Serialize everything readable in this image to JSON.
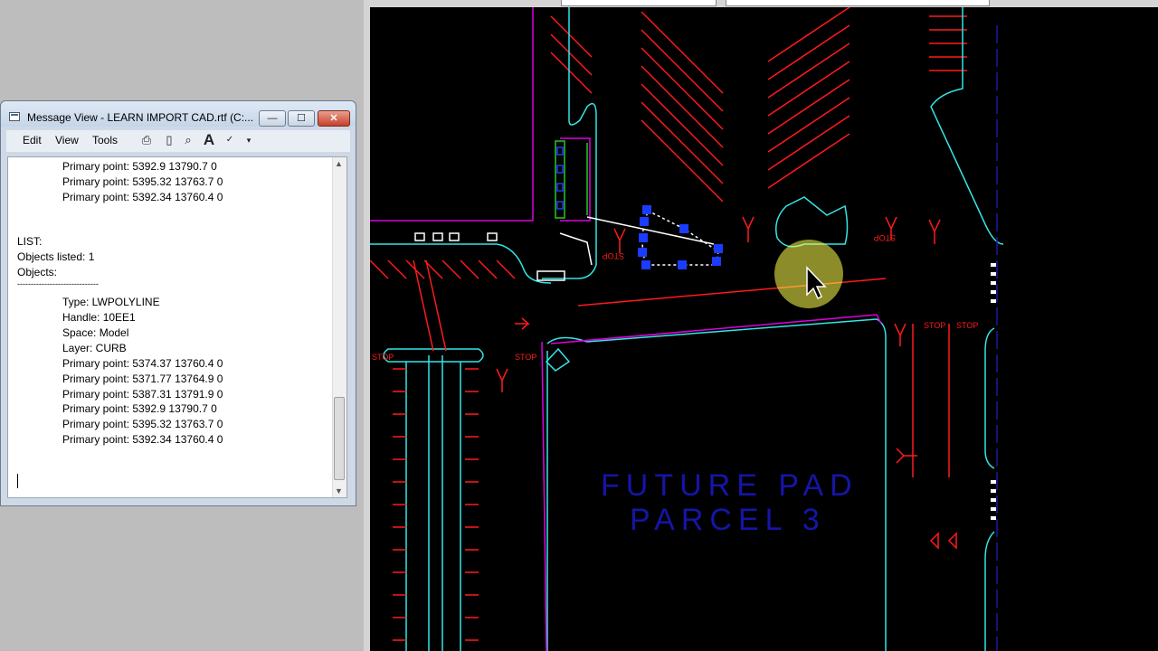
{
  "message_view": {
    "title": "Message View - LEARN IMPORT CAD.rtf (C:...",
    "buttons": {
      "minimize": "—",
      "maximize": "☐",
      "close": "✕"
    },
    "menu": [
      "Edit",
      "View",
      "Tools"
    ],
    "lines": [
      "Primary point: 5392.9 13790.7 0",
      "Primary point: 5395.32 13763.7 0",
      "Primary point: 5392.34 13760.4 0",
      "LIST:",
      "Objects listed: 1",
      "Objects:",
      "------------------------------",
      "Type: LWPOLYLINE",
      "Handle: 10EE1",
      "Space: Model",
      "Layer: CURB",
      "Primary point: 5374.37 13760.4 0",
      "Primary point: 5371.77 13764.9 0",
      "Primary point: 5387.31 13791.9 0",
      "Primary point: 5392.9 13790.7 0",
      "Primary point: 5395.32 13763.7 0",
      "Primary point: 5392.34 13760.4 0"
    ]
  },
  "cad": {
    "pad_label_line1": "FUTURE PAD",
    "pad_label_line2": "PARCEL 3",
    "stop_text": "STOP",
    "colors": {
      "red": "#ff1a1a",
      "cyan": "#33e6e6",
      "magenta": "#e000e0",
      "white": "#ffffff",
      "blue_label": "#1515a8",
      "green": "#22cc22",
      "selection": "#1a3cff",
      "highlight": "#ffff4d"
    }
  },
  "icons": {
    "print": "print-icon",
    "page": "page-icon",
    "find": "find-icon",
    "font": "font-icon",
    "spell": "spellcheck-icon",
    "more": "more-icon"
  }
}
